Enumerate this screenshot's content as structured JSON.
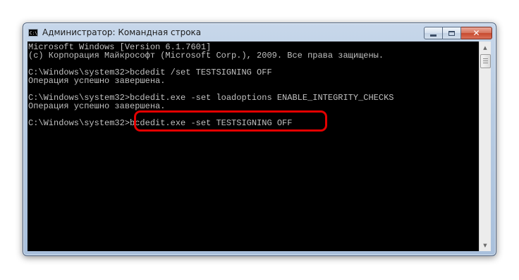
{
  "window": {
    "title": "Администратор: Командная строка",
    "icon_label": "C:\\",
    "icon_name": "cmd-app-icon",
    "close_glyph": "✕"
  },
  "console": {
    "text_color": "#c0c0c0",
    "background": "#000000",
    "lines": [
      "Microsoft Windows [Version 6.1.7601]",
      "(c) Корпорация Майкрософт (Microsoft Corp.), 2009. Все права защищены.",
      "",
      "C:\\Windows\\system32>bcdedit /set TESTSIGNING OFF",
      "Операция успешно завершена.",
      "",
      "C:\\Windows\\system32>bcdedit.exe -set loadoptions ENABLE_INTEGRITY_CHECKS",
      "Операция успешно завершена.",
      "",
      "C:\\Windows\\system32>bcdedit.exe -set TESTSIGNING OFF"
    ]
  },
  "highlight_color": "#e30000"
}
